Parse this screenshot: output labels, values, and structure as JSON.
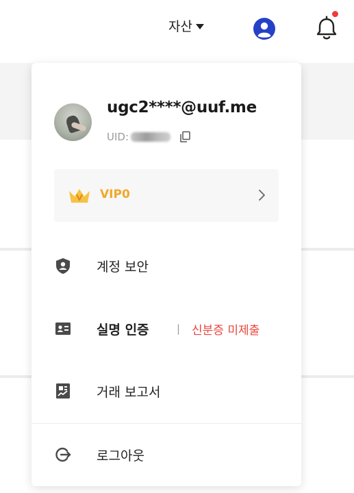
{
  "header": {
    "assets_label": "자산",
    "icons": [
      "user-circle-icon",
      "bell-icon"
    ],
    "notification_dot_color": "#ef3b3b",
    "user_icon_color": "#2541c7"
  },
  "account_menu": {
    "email": "ugc2****@uuf.me",
    "uid_label": "UID:",
    "uid_value_masked": true,
    "vip": {
      "label": "VIP0",
      "color": "#f0a82a"
    },
    "items": [
      {
        "label": "계정 보안",
        "icon": "shield-user-icon"
      },
      {
        "label": "실명 인증",
        "icon": "id-card-icon",
        "separator": "|",
        "status": "신분증 미제출",
        "status_color": "#e8453c"
      },
      {
        "label": "거래 보고서",
        "icon": "report-chart-icon"
      },
      {
        "label": "로그아웃",
        "icon": "logout-icon"
      }
    ]
  }
}
